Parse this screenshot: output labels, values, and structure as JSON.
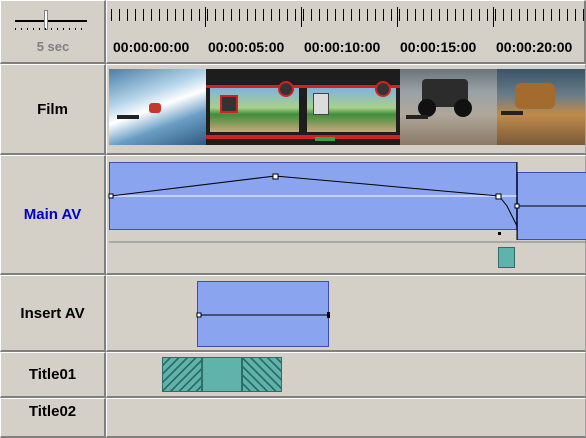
{
  "zoom": {
    "label": "5 sec"
  },
  "ruler": {
    "timecodes": [
      "00:00:00:00",
      "00:00:05:00",
      "00:00:10:00",
      "00:00:15:00",
      "00:00:20:00"
    ]
  },
  "tracks": [
    {
      "label": "Film",
      "color": "#000000"
    },
    {
      "label": "Main AV",
      "color": "#0000cc"
    },
    {
      "label": "Insert AV",
      "color": "#000000"
    },
    {
      "label": "Title01",
      "color": "#000000"
    },
    {
      "label": "Title02",
      "color": "#000000"
    }
  ],
  "colors": {
    "clip_fill": "#8aa4f0",
    "clip_border": "#3a4fb0",
    "title_fill": "#5fb3aa",
    "background": "#d4d0c8"
  }
}
